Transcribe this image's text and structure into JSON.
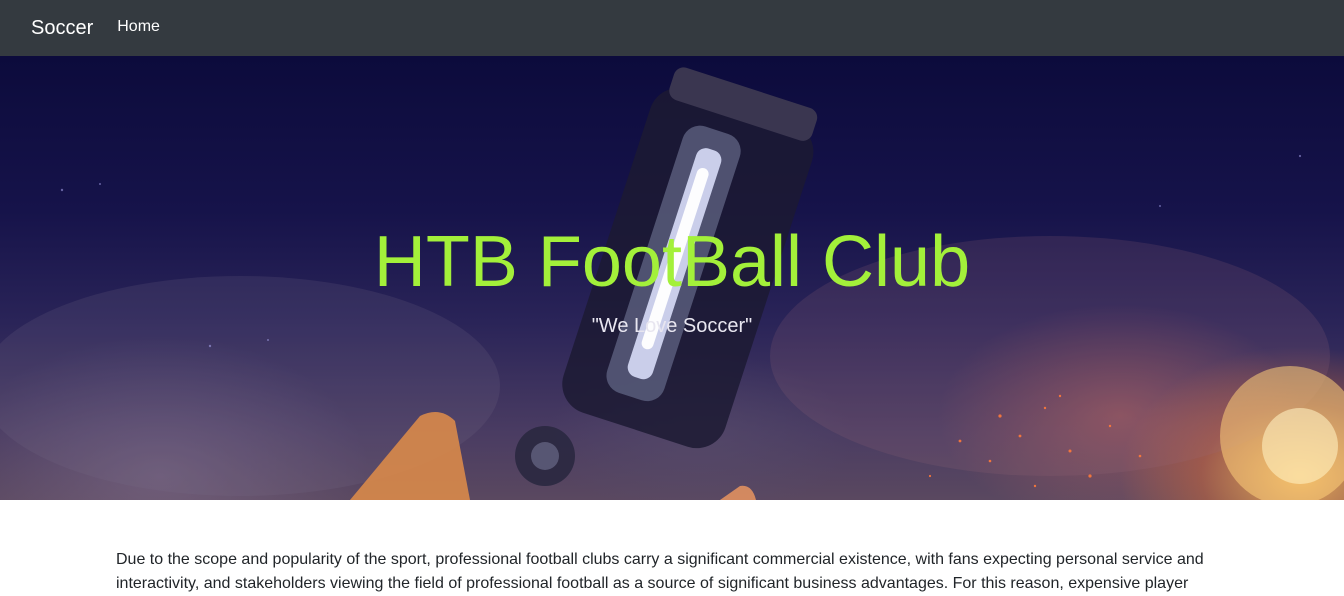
{
  "navbar": {
    "brand": "Soccer",
    "links": [
      {
        "label": "Home"
      }
    ]
  },
  "hero": {
    "title": "HTB FootBall Club",
    "subtitle": "\"We Love Soccer\""
  },
  "main": {
    "paragraph": "Due to the scope and popularity of the sport, professional football clubs carry a significant commercial existence, with fans expecting personal service and interactivity, and stakeholders viewing the field of professional football as a source of significant business advantages. For this reason, expensive player"
  },
  "colors": {
    "navbar_bg": "#343a40",
    "hero_title": "#a3f03a",
    "body_text": "#212529"
  }
}
